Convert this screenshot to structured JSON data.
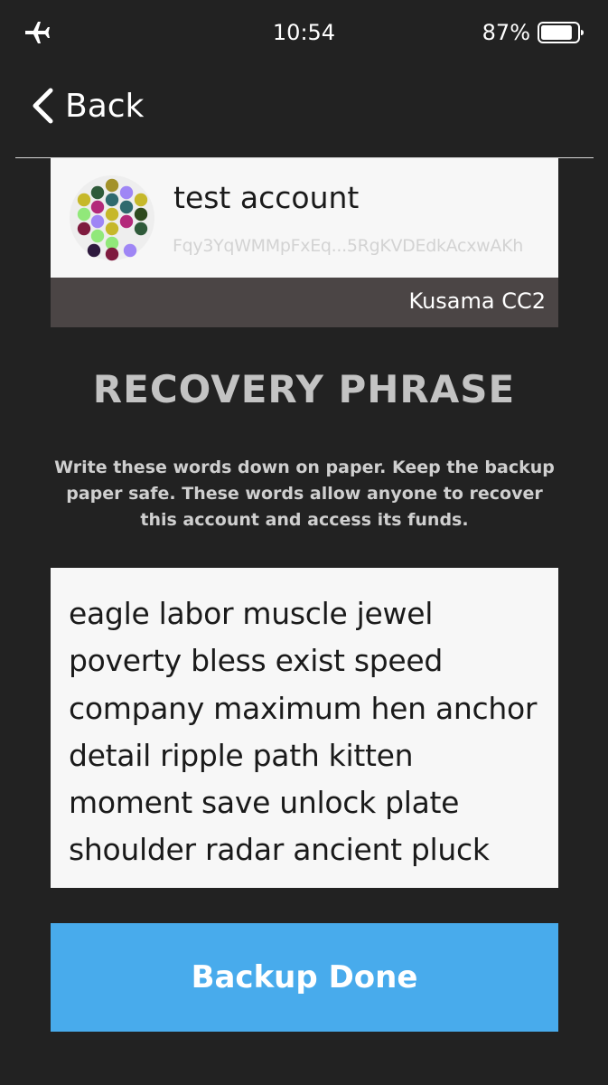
{
  "status_bar": {
    "time": "10:54",
    "battery_percent": "87%",
    "battery_level": 0.87,
    "airplane_icon": "airplane-icon",
    "battery_icon": "battery-icon"
  },
  "nav": {
    "back_label": "Back",
    "back_icon": "chevron-left-icon"
  },
  "account": {
    "name": "test account",
    "address": "Fqy3YqWMMpFxEq...5RgKVDEdkAcxwAKh",
    "network": "Kusama CC2",
    "identicon_colors": [
      "#a3922a",
      "#2f5a3a",
      "#2f6a6e",
      "#9f86f5",
      "#c6b82a",
      "#b3297a",
      "#2f6a6e",
      "#c6b82a",
      "#91e87a",
      "#9f86f5",
      "#c6b82a",
      "#b3297a",
      "#2f4a1e",
      "#7e1a3e",
      "#c6b82a",
      "#91e87a",
      "#2f5a3a",
      "#2e1a3e",
      "#91e87a",
      "#9f86f5",
      "#7e1a3e"
    ]
  },
  "recovery": {
    "title": "RECOVERY PHRASE",
    "instructions": "Write these words down on paper. Keep the backup paper safe. These words allow anyone to recover this account and access its funds.",
    "phrase": "eagle labor muscle jewel\npoverty bless exist speed\ncompany maximum hen anchor\ndetail ripple path kitten\nmoment save unlock plate\nshoulder radar ancient pluck"
  },
  "actions": {
    "backup_done_label": "Backup Done"
  },
  "colors": {
    "background": "#222222",
    "card": "#f7f7f7",
    "network_bar": "#4b4545",
    "accent_button": "#48abec",
    "title_gray": "#c3c3c3"
  }
}
